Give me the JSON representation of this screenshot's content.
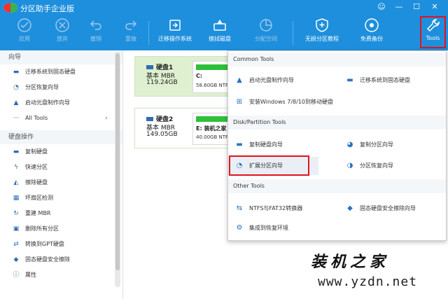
{
  "app": {
    "title": "分区助手企业版",
    "window_buttons": [
      "☺",
      "—",
      "☐",
      "✕"
    ]
  },
  "toolbar": {
    "buttons": [
      {
        "label": "应用",
        "icon": "apply-icon",
        "enabled": false
      },
      {
        "label": "放弃",
        "icon": "discard-icon",
        "enabled": false
      },
      {
        "label": "撤销",
        "icon": "undo-icon",
        "enabled": false
      },
      {
        "label": "重做",
        "icon": "redo-icon",
        "enabled": false
      },
      {
        "label": "迁移操作系统",
        "icon": "migrate-os-icon",
        "enabled": true
      },
      {
        "label": "擦拭磁盘",
        "icon": "wipe-disk-icon",
        "enabled": true
      },
      {
        "label": "分配空间",
        "icon": "allocate-space-icon",
        "enabled": false
      },
      {
        "label": "无损分区教程",
        "icon": "shield-icon",
        "enabled": true
      },
      {
        "label": "免费备份",
        "icon": "backup-icon",
        "enabled": true
      },
      {
        "label": "Tools",
        "icon": "wrench-icon",
        "enabled": true
      }
    ]
  },
  "sidebar": {
    "wizard_section": "向导",
    "wizard_items": [
      {
        "label": "迁移系统到固态硬盘",
        "icon": "migrate-ssd-icon"
      },
      {
        "label": "分区恢复向导",
        "icon": "partition-recovery-icon"
      },
      {
        "label": "启动光盘制作向导",
        "icon": "bootable-disc-icon"
      },
      {
        "label": "All Tools",
        "icon": "all-tools-icon"
      }
    ],
    "disk_section": "硬盘操作",
    "disk_items": [
      {
        "label": "复制硬盘",
        "icon": "copy-disk-icon"
      },
      {
        "label": "快速分区",
        "icon": "quick-partition-icon"
      },
      {
        "label": "擦除硬盘",
        "icon": "erase-disk-icon"
      },
      {
        "label": "坏扇区检测",
        "icon": "bad-sector-icon"
      },
      {
        "label": "重建 MBR",
        "icon": "rebuild-mbr-icon"
      },
      {
        "label": "删除所有分区",
        "icon": "delete-partitions-icon"
      },
      {
        "label": "转换到GPT硬盘",
        "icon": "convert-gpt-icon"
      },
      {
        "label": "固态硬盘安全擦除",
        "icon": "ssd-secure-erase-icon"
      },
      {
        "label": "属性",
        "icon": "properties-icon"
      }
    ]
  },
  "disks": [
    {
      "name": "硬盘1",
      "type": "基本 MBR",
      "size": "119.24GB",
      "partition_name": "C:",
      "partition_info": "58.60GB NTF",
      "usage_fraction": 0.55
    },
    {
      "name": "硬盘2",
      "type": "基本 MBR",
      "size": "149.05GB",
      "partition_name": "E: 装机之家",
      "partition_info": "40.00GB NTF",
      "usage_fraction": 0.5
    }
  ],
  "tools_menu": {
    "common_section": "Common Tools",
    "common_items": [
      {
        "label": "启动光盘制作向导",
        "icon": "bootable-disc-icon"
      },
      {
        "label": "迁移系统到固态硬盘",
        "icon": "migrate-ssd-icon"
      },
      {
        "label": "安装Windows 7/8/10到移动硬盘",
        "icon": "windows-icon"
      }
    ],
    "disk_section": "Disk/Partition Tools",
    "disk_items": [
      {
        "label": "复制硬盘向导",
        "icon": "copy-disk-icon"
      },
      {
        "label": "复制分区向导",
        "icon": "copy-partition-icon"
      },
      {
        "label": "扩展分区向导",
        "icon": "extend-partition-icon"
      },
      {
        "label": "分区恢复向导",
        "icon": "partition-recovery-icon"
      }
    ],
    "other_section": "Other Tools",
    "other_items": [
      {
        "label": "NTFS与FAT32转换器",
        "icon": "convert-fs-icon"
      },
      {
        "label": "固态硬盘安全擦除向导",
        "icon": "ssd-secure-erase-icon"
      },
      {
        "label": "集成到恢复环境",
        "icon": "recovery-env-icon"
      }
    ]
  },
  "watermark": {
    "title": "装机之家",
    "url": "www.yzdn.net"
  },
  "colors": {
    "toolbar_bg": "#1e8fdc",
    "highlight_red": "#e0141e",
    "disk_selected": "#dff0d0",
    "usage_green": "#2fbf3b"
  }
}
